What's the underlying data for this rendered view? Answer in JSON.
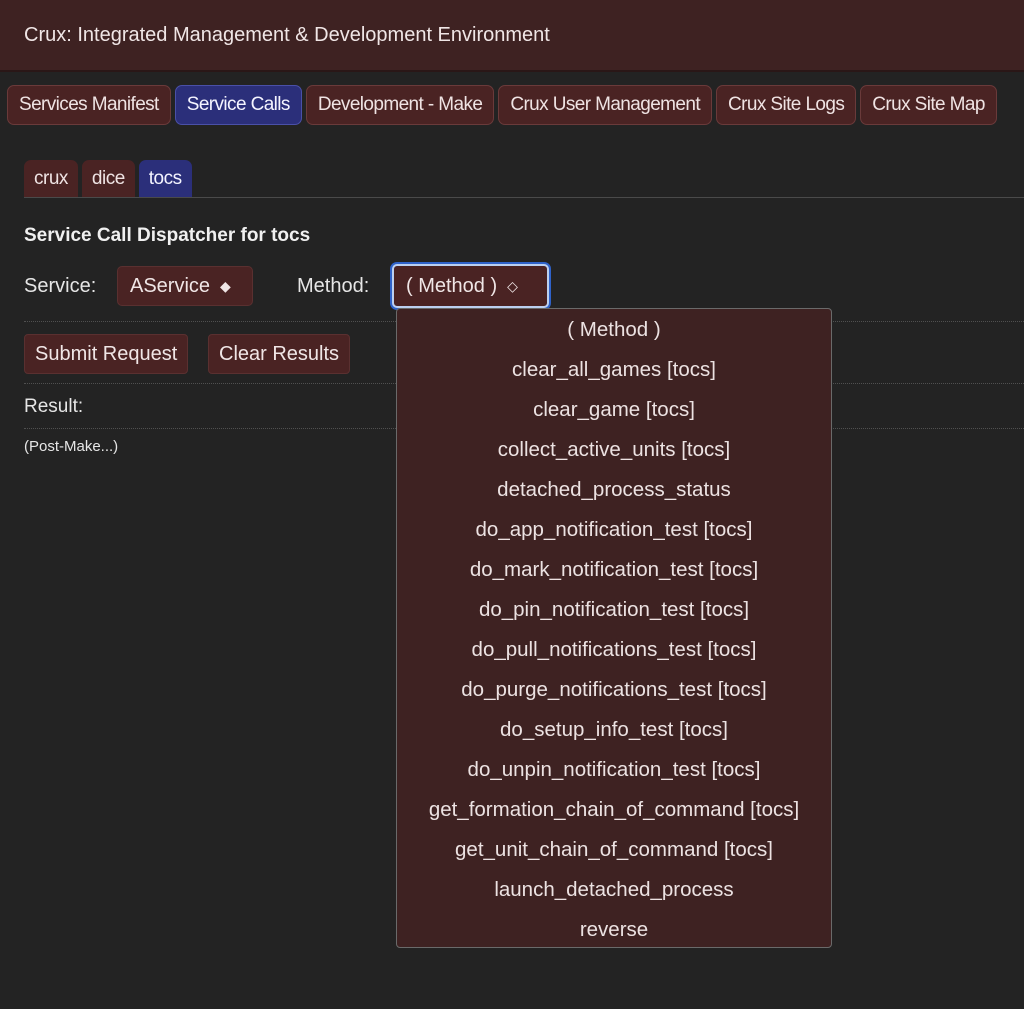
{
  "header": {
    "title": "Crux: Integrated Management & Development Environment"
  },
  "main_tabs": [
    {
      "label": "Services Manifest",
      "active": false
    },
    {
      "label": "Service Calls",
      "active": true
    },
    {
      "label": "Development - Make",
      "active": false
    },
    {
      "label": "Crux User Management",
      "active": false
    },
    {
      "label": "Crux Site Logs",
      "active": false
    },
    {
      "label": "Crux Site Map",
      "active": false
    }
  ],
  "sub_tabs": [
    {
      "label": "crux",
      "active": false
    },
    {
      "label": "dice",
      "active": false
    },
    {
      "label": "tocs",
      "active": true
    }
  ],
  "dispatcher": {
    "heading": "Service Call Dispatcher for tocs",
    "service_label": "Service:",
    "service_value": "AService",
    "service_arrow": "◆",
    "method_label": "Method:",
    "method_value": "( Method )",
    "method_arrow": "◇"
  },
  "actions": {
    "submit_label": "Submit Request",
    "clear_label": "Clear Results"
  },
  "result": {
    "label": "Result:",
    "text": "(Post-Make...)"
  },
  "method_options": [
    "( Method )",
    "clear_all_games [tocs]",
    "clear_game [tocs]",
    "collect_active_units [tocs]",
    "detached_process_status",
    "do_app_notification_test [tocs]",
    "do_mark_notification_test [tocs]",
    "do_pin_notification_test [tocs]",
    "do_pull_notifications_test [tocs]",
    "do_purge_notifications_test [tocs]",
    "do_setup_info_test [tocs]",
    "do_unpin_notification_test [tocs]",
    "get_formation_chain_of_command [tocs]",
    "get_unit_chain_of_command [tocs]",
    "launch_detached_process",
    "reverse"
  ],
  "colors": {
    "background": "#232323",
    "header": "#3e2222",
    "tab_inactive": "#4a2323",
    "tab_active": "#2b2f7a",
    "focus_ring": "#2f62c9"
  }
}
